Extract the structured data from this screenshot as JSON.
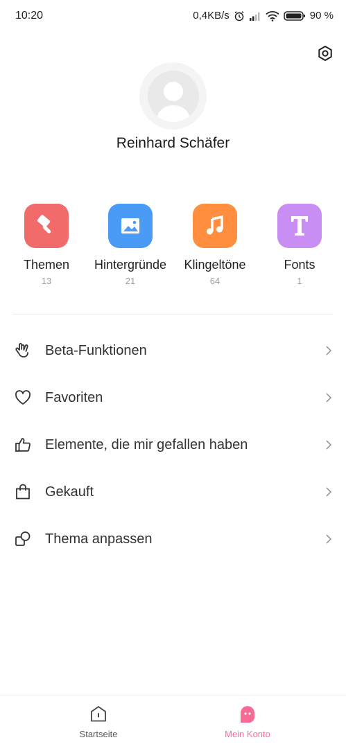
{
  "status_bar": {
    "time": "10:20",
    "speed": "0,4KB/s",
    "battery": "90 %",
    "icons": [
      "alarm-icon",
      "signal-icon",
      "wifi-icon",
      "battery-icon"
    ]
  },
  "profile": {
    "name": "Reinhard Schäfer"
  },
  "categories": [
    {
      "label": "Themen",
      "count": "13",
      "color": "#f16b6b",
      "icon": "brush-icon"
    },
    {
      "label": "Hintergründe",
      "count": "21",
      "color": "#4a9bf5",
      "icon": "image-icon"
    },
    {
      "label": "Klingeltöne",
      "count": "64",
      "color": "#ff8f3f",
      "icon": "music-note-icon"
    },
    {
      "label": "Fonts",
      "count": "1",
      "color": "#c98ef4",
      "icon": "font-icon"
    }
  ],
  "menu": [
    {
      "label": "Beta-Funktionen",
      "icon": "hand-gesture-icon"
    },
    {
      "label": "Favoriten",
      "icon": "heart-icon"
    },
    {
      "label": "Elemente, die mir gefallen haben",
      "icon": "thumbs-up-icon"
    },
    {
      "label": "Gekauft",
      "icon": "shopping-bag-icon"
    },
    {
      "label": "Thema anpassen",
      "icon": "customize-icon"
    }
  ],
  "bottom_nav": [
    {
      "label": "Startseite",
      "icon": "home-icon",
      "active": false
    },
    {
      "label": "Mein Konto",
      "icon": "account-icon",
      "active": true
    }
  ],
  "colors": {
    "accent": "#f76b94",
    "inactive": "#555555"
  }
}
